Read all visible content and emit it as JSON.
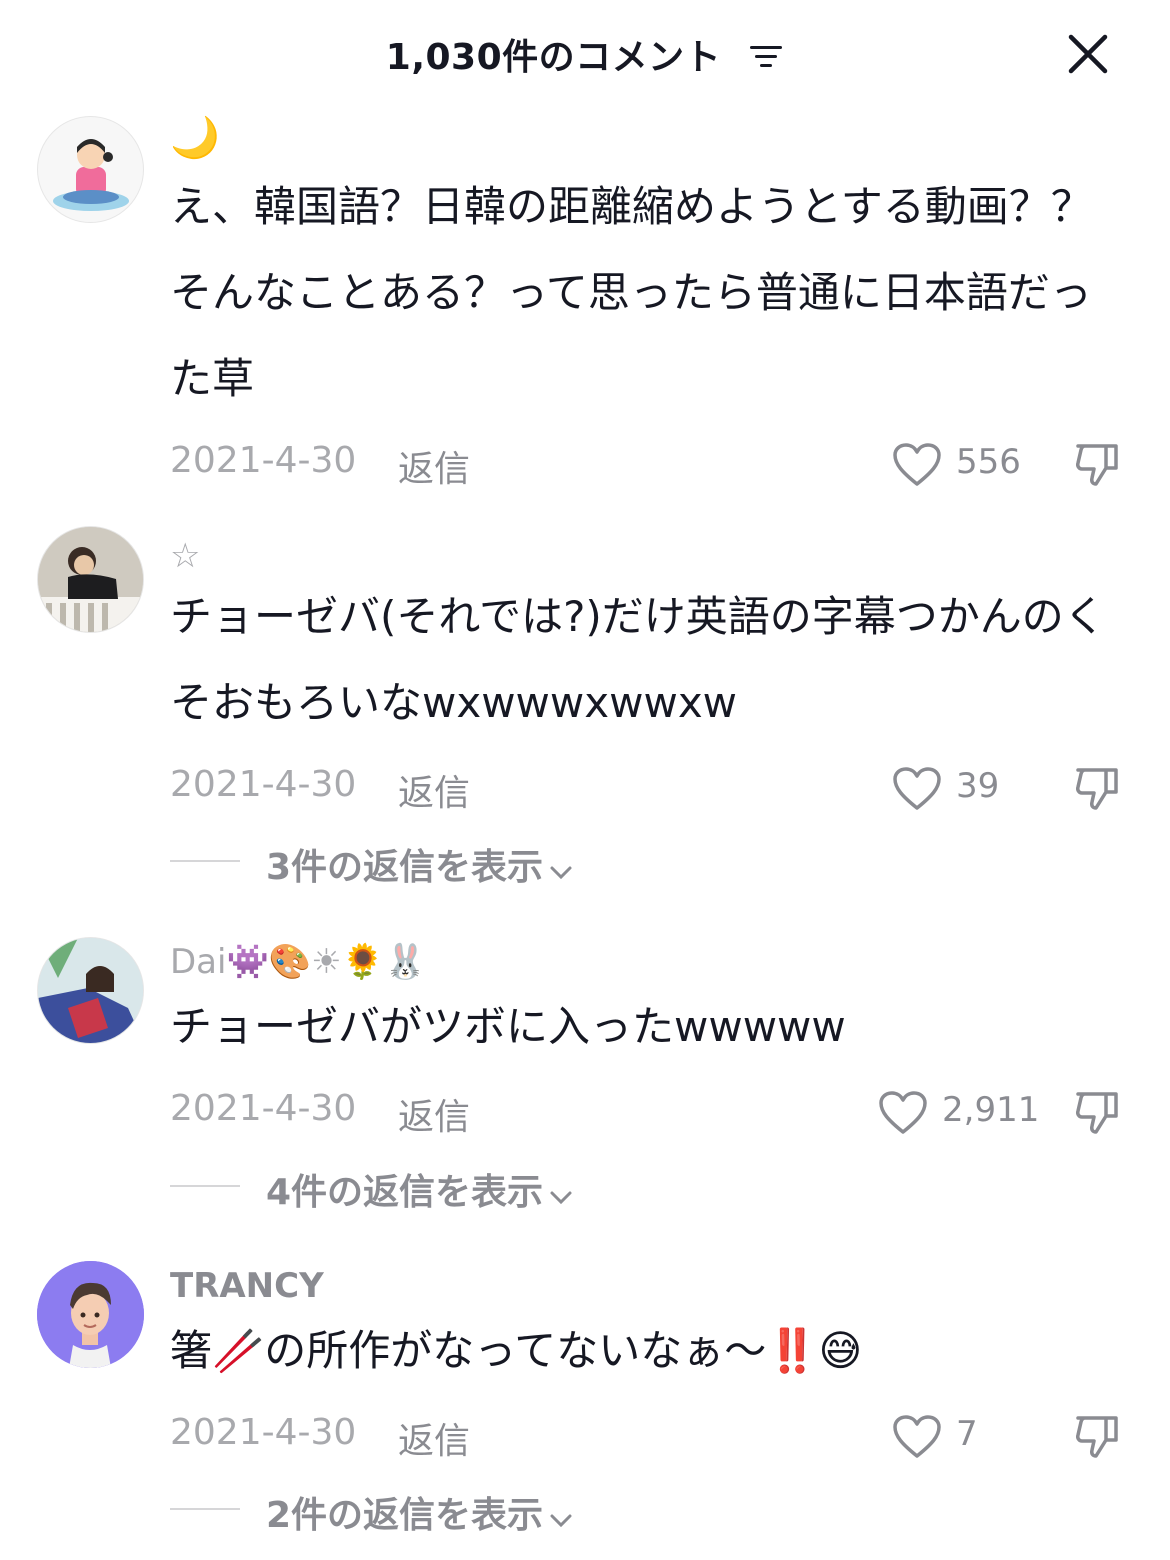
{
  "header": {
    "title": "1,030件のコメント",
    "sort_icon": "sort-lines-icon",
    "close_icon": "close-icon"
  },
  "comments": [
    {
      "username": "🌙",
      "text": "え、韓国語？日韓の距離縮めようとする動画？？そんなことある？って思ったら普通に日本語だった草",
      "date": "2021-4-30",
      "reply_label": "返信",
      "likes": "556"
    },
    {
      "username": "☆",
      "text": "チョーゼバ(それでは?)だけ英語の字幕つかんのくそおもろいなwxwwwxwwxw",
      "date": "2021-4-30",
      "reply_label": "返信",
      "likes": "39",
      "view_replies": "3件の返信を表示"
    },
    {
      "username": "Dai👾🎨☀🌻🐰",
      "text": "チョーゼバがツボに入ったwwwww",
      "date": "2021-4-30",
      "reply_label": "返信",
      "likes": "2,911",
      "view_replies": "4件の返信を表示"
    },
    {
      "username": "TRANCY",
      "text": "箸🥢の所作がなってないなぁ〜‼️😅",
      "date": "2021-4-30",
      "reply_label": "返信",
      "likes": "7",
      "view_replies": "2件の返信を表示"
    }
  ],
  "colors": {
    "primary_text": "#161823",
    "secondary_text": "#8a8b91",
    "date_text": "#a8a9ad",
    "avatar_trancy_bg": "#8c7cf0"
  }
}
